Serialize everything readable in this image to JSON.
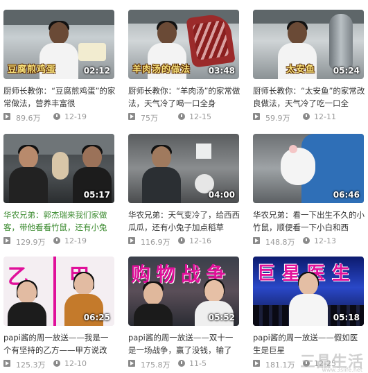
{
  "videos": [
    {
      "title": "厨师长教你：“豆腐煎鸡蛋”的家常做法，营养丰富很",
      "overlay": "豆腐煎鸡蛋",
      "duration": "02:12",
      "views": "89.6万",
      "date": "12-19",
      "scene": "chef",
      "title_color": "default"
    },
    {
      "title": "厨师长教你：“羊肉汤”的家常做法，天气冷了喝一口全身",
      "overlay": "羊肉汤的做法",
      "duration": "03:48",
      "views": "75万",
      "date": "12-15",
      "scene": "chef-meat",
      "title_color": "default"
    },
    {
      "title": "厨师长教你：“太安鱼”的家常改良做法，天气冷了吃一口全",
      "overlay": "太安鱼",
      "duration": "05:24",
      "views": "59.9万",
      "date": "12-11",
      "scene": "chef-fish",
      "title_color": "default"
    },
    {
      "title": "华农兄弟：郭杰瑞来我们家做客，带他看看竹鼠，还有小兔",
      "overlay": "",
      "duration": "05:17",
      "views": "129.9万",
      "date": "12-19",
      "scene": "farm-dark",
      "title_color": "green"
    },
    {
      "title": "华农兄弟：天气变冷了，给西西瓜瓜，还有小兔子加点稻草",
      "overlay": "",
      "duration": "04:00",
      "views": "116.9万",
      "date": "12-16",
      "scene": "farm-grey",
      "title_color": "default"
    },
    {
      "title": "华农兄弟：看一下出生不久的小竹鼠，顺便看一下小白和西",
      "overlay": "",
      "duration": "06:46",
      "views": "148.8万",
      "date": "12-13",
      "scene": "farm-rat",
      "title_color": "default"
    },
    {
      "title": "papi酱的周一放送——我是一个有坚持的乙方——甲方说改",
      "overlay": "乙 甲",
      "duration": "06:25",
      "views": "125.3万",
      "date": "12-10",
      "scene": "papi-1",
      "title_color": "default"
    },
    {
      "title": "papi酱的周一放送——双十一是一场战争，赢了没钱，输了",
      "overlay": "购物战争",
      "duration": "05:52",
      "views": "175.8万",
      "date": "11-5",
      "scene": "papi-2",
      "title_color": "default"
    },
    {
      "title": "papi酱的周一放送——假如医生是巨星",
      "overlay": "巨星医生",
      "duration": "05:18",
      "views": "181.1万",
      "date": "12-25",
      "scene": "papi-3",
      "title_color": "default"
    }
  ],
  "watermark": {
    "text": "三晶生活",
    "url": "www.3slife.net"
  },
  "colors": {
    "green_title": "#3a8a2e",
    "meta_gray": "#999999",
    "overlay_yellow": "#f6e07a",
    "papi_magenta": "#e0109a"
  },
  "icons": [
    "play-count-icon",
    "clock-icon"
  ]
}
